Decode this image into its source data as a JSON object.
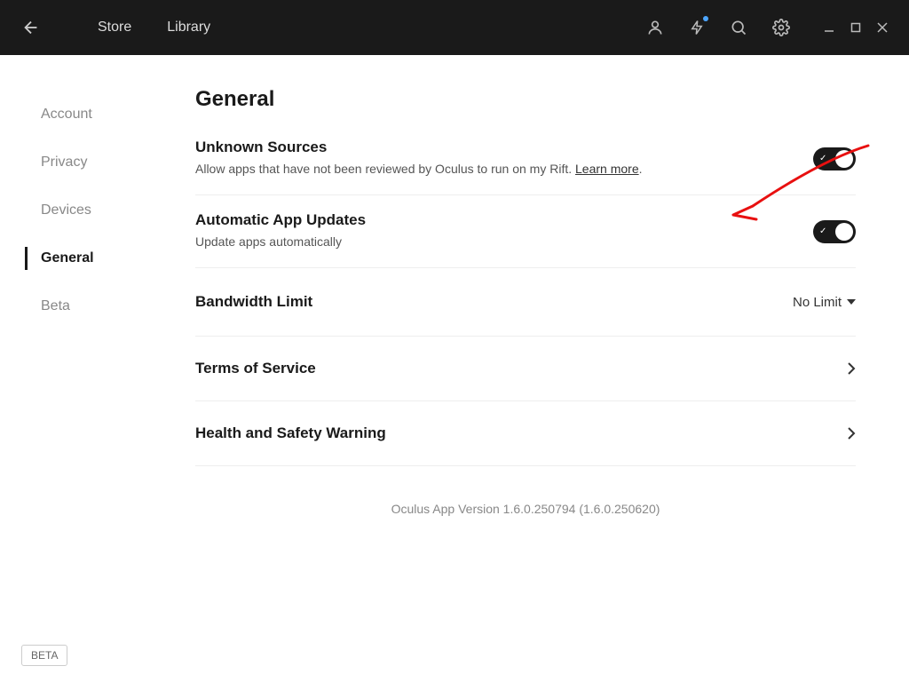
{
  "header": {
    "nav": {
      "store": "Store",
      "library": "Library"
    }
  },
  "sidebar": {
    "items": [
      {
        "label": "Account"
      },
      {
        "label": "Privacy"
      },
      {
        "label": "Devices"
      },
      {
        "label": "General"
      },
      {
        "label": "Beta"
      }
    ]
  },
  "main": {
    "title": "General",
    "unknown_sources": {
      "title": "Unknown Sources",
      "desc_prefix": "Allow apps that have not been reviewed by Oculus to run on my Rift. ",
      "learn_more": "Learn more",
      "desc_suffix": "."
    },
    "auto_updates": {
      "title": "Automatic App Updates",
      "desc": "Update apps automatically"
    },
    "bandwidth": {
      "title": "Bandwidth Limit",
      "value": "No Limit"
    },
    "tos": {
      "title": "Terms of Service"
    },
    "health": {
      "title": "Health and Safety Warning"
    },
    "version": "Oculus App Version 1.6.0.250794 (1.6.0.250620)"
  },
  "footer": {
    "beta": "BETA"
  }
}
